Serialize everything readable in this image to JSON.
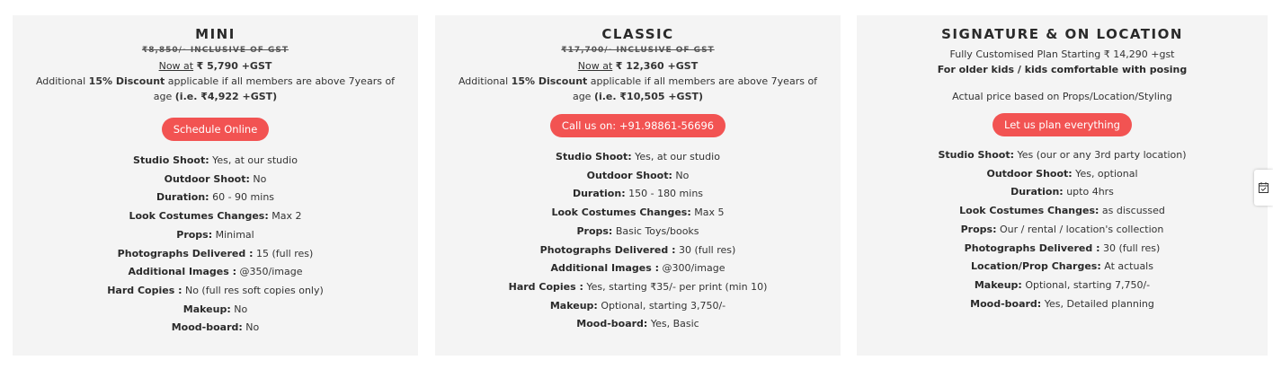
{
  "plans": [
    {
      "title": "MINI",
      "original_price": "₹8,850/- INCLUSIVE OF GST",
      "now_label": "Now at",
      "now_price": "₹ 5,790 +GST",
      "discount": {
        "prefix": "Additional ",
        "bold1": "15% Discount",
        "middle": " applicable if all members are above 7years of age ",
        "bold2": "(i.e. ₹4,922 +GST)"
      },
      "button_label": "Schedule Online",
      "specs": [
        {
          "label": "Studio Shoot:",
          "value": " Yes, at our studio"
        },
        {
          "label": "Outdoor Shoot:",
          "value": " No"
        },
        {
          "label": "Duration:",
          "value": " 60 - 90 mins"
        },
        {
          "label": "Look Costumes Changes:",
          "value": " Max 2"
        },
        {
          "label": "Props:",
          "value": " Minimal"
        },
        {
          "label": "Photographs Delivered :",
          "value": " 15 (full res)"
        },
        {
          "label": "Additional Images :",
          "value": " @350/image"
        },
        {
          "label": "Hard Copies :",
          "value": " No (full res soft copies only)"
        },
        {
          "label": "Makeup:",
          "value": " No"
        },
        {
          "label": "Mood-board:",
          "value": " No"
        }
      ]
    },
    {
      "title": "CLASSIC",
      "original_price": "₹17,700/- INCLUSIVE OF GST",
      "now_label": "Now at",
      "now_price": "₹ 12,360 +GST",
      "discount": {
        "prefix": "Additional ",
        "bold1": "15% Discount",
        "middle": " applicable if all members are above 7years of age ",
        "bold2": "(i.e. ₹10,505 +GST)"
      },
      "button_label": "Call us on: +91.98861-56696",
      "specs": [
        {
          "label": "Studio Shoot:",
          "value": " Yes, at our studio"
        },
        {
          "label": "Outdoor Shoot:",
          "value": " No"
        },
        {
          "label": "Duration:",
          "value": " 150 - 180 mins"
        },
        {
          "label": "Look Costumes Changes:",
          "value": " Max 5"
        },
        {
          "label": "Props:",
          "value": " Basic Toys/books"
        },
        {
          "label": "Photographs Delivered :",
          "value": " 30 (full res)"
        },
        {
          "label": "Additional Images :",
          "value": " @300/image"
        },
        {
          "label": "Hard Copies :",
          "value": " Yes, starting ₹35/- per print (min 10)"
        },
        {
          "label": "Makeup:",
          "value": " Optional, starting 3,750/-"
        },
        {
          "label": "Mood-board:",
          "value": " Yes, Basic"
        }
      ]
    },
    {
      "title": "SIGNATURE & ON LOCATION",
      "subtitle": "Fully Customised Plan Starting ₹ 14,290 +gst",
      "audience": "For older kids / kids comfortable with posing",
      "price_note": "Actual price based on Props/Location/Styling",
      "button_label": "Let us plan everything",
      "specs": [
        {
          "label": "Studio Shoot:",
          "value": " Yes (our or any 3rd party location)"
        },
        {
          "label": "Outdoor Shoot:",
          "value": " Yes, optional"
        },
        {
          "label": "Duration:",
          "value": " upto 4hrs"
        },
        {
          "label": "Look Costumes Changes:",
          "value": " as discussed"
        },
        {
          "label": "Props:",
          "value": " Our / rental / location's collection"
        },
        {
          "label": "Photographs Delivered :",
          "value": " 30 (full res)"
        },
        {
          "label": "Location/Prop Charges:",
          "value": " At actuals"
        },
        {
          "label": "Makeup:",
          "value": " Optional, starting 7,750/-"
        },
        {
          "label": "Mood-board:",
          "value": " Yes, Detailed planning"
        }
      ]
    }
  ],
  "side_widget": {
    "icon": "calendar-check-icon"
  },
  "colors": {
    "accent": "#f25352",
    "card_bg": "#f4f4f4"
  }
}
